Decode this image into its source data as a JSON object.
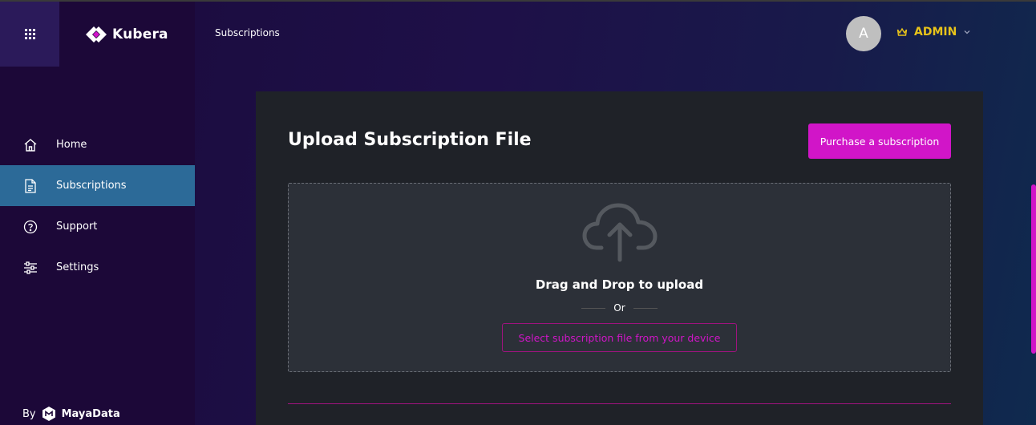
{
  "app": {
    "name": "Kubera"
  },
  "header": {
    "breadcrumb": "Subscriptions",
    "avatar_initial": "A",
    "user_role": "ADMIN"
  },
  "sidebar": {
    "items": [
      {
        "label": "Home",
        "icon": "home-icon",
        "active": false
      },
      {
        "label": "Subscriptions",
        "icon": "document-icon",
        "active": true
      },
      {
        "label": "Support",
        "icon": "help-icon",
        "active": false
      },
      {
        "label": "Settings",
        "icon": "settings-icon",
        "active": false
      }
    ],
    "footer": {
      "by": "By",
      "brand": "MayaData"
    }
  },
  "main": {
    "title": "Upload Subscription File",
    "purchase_label": "Purchase a subscription",
    "dropzone": {
      "drag_text": "Drag and Drop to upload",
      "or_text": "Or",
      "select_label": "Select subscription file from your device"
    }
  },
  "colors": {
    "accent": "#d115c8",
    "active_nav": "#2c6a98",
    "role": "#e8c31a"
  }
}
